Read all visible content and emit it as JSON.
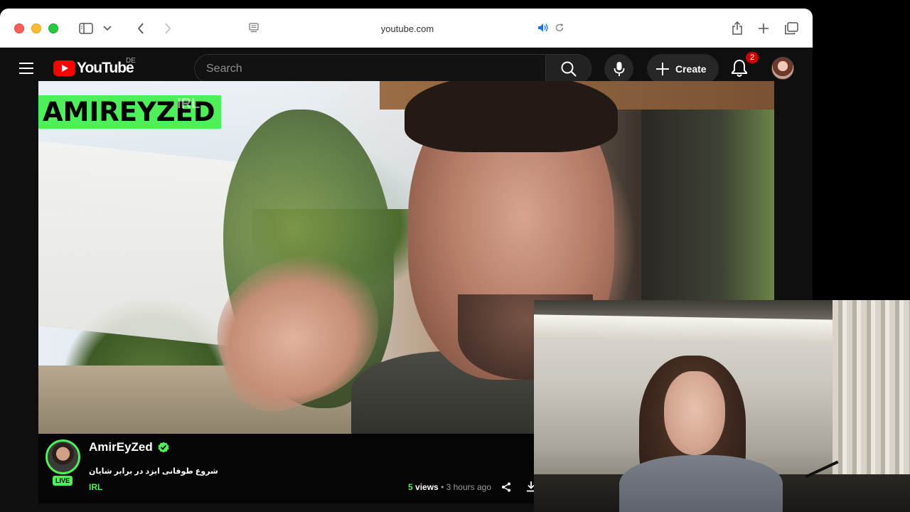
{
  "browser": {
    "url": "youtube.com"
  },
  "youtube": {
    "logo_text": "YouTube",
    "region": "DE",
    "search_placeholder": "Search",
    "create_label": "Create",
    "notification_count": "2"
  },
  "video": {
    "watermark": "AMIREYZED",
    "watermark_sub": "IRL"
  },
  "stream": {
    "channel_name": "AmirEyZed",
    "live_badge": "LIVE",
    "title": "شروع طوفانی ایزد در برابر شایان",
    "category": "IRL",
    "views_count": "5",
    "views_label": "views",
    "separator": "•",
    "time_ago": "3 hours ago"
  },
  "colors": {
    "accent_green": "#4ef05a",
    "youtube_red": "#ff0000",
    "notification_red": "#cc0000"
  },
  "icons": [
    "sidebar-icon",
    "chevron-down-icon",
    "back-icon",
    "forward-icon",
    "reader-icon",
    "speaker-icon",
    "reload-icon",
    "share-icon",
    "new-tab-icon",
    "tabs-overview-icon",
    "menu-icon",
    "search-icon",
    "mic-icon",
    "plus-icon",
    "bell-icon",
    "verified-icon",
    "download-icon"
  ]
}
